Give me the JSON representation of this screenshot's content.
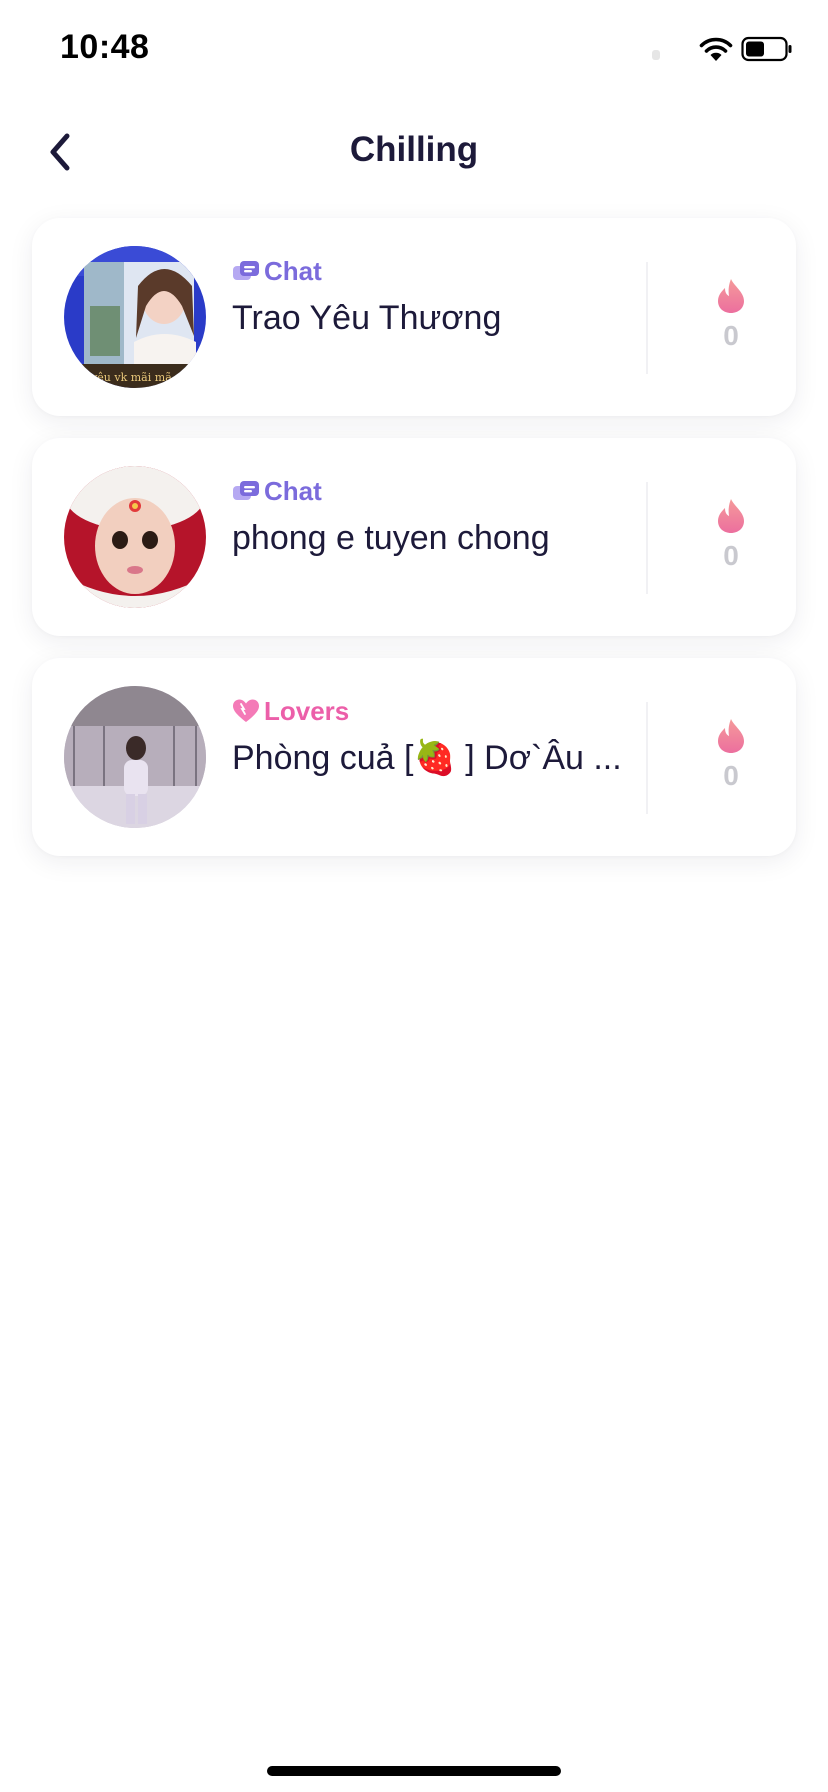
{
  "status_bar": {
    "time": "10:48"
  },
  "nav": {
    "title": "Chilling",
    "back_icon": "chevron-left-icon"
  },
  "rooms": [
    {
      "tag": "Chat",
      "tag_icon": "chat-bubbles-icon",
      "name": "Trao Yêu Thương",
      "heat": "0"
    },
    {
      "tag": "Chat",
      "tag_icon": "chat-bubbles-icon",
      "name": "phong e tuyen chong",
      "heat": "0"
    },
    {
      "tag": "Lovers",
      "tag_icon": "heart-icon",
      "name": "Phòng cuả [🍓 ] Dơ`Âu ...",
      "heat": "0"
    }
  ],
  "colors": {
    "title": "#1d1a3a",
    "chat_tag": "#7b6bdc",
    "lovers_tag": "#ec5fa9",
    "flame": "#f07a9c",
    "count": "#c9c9cf"
  }
}
